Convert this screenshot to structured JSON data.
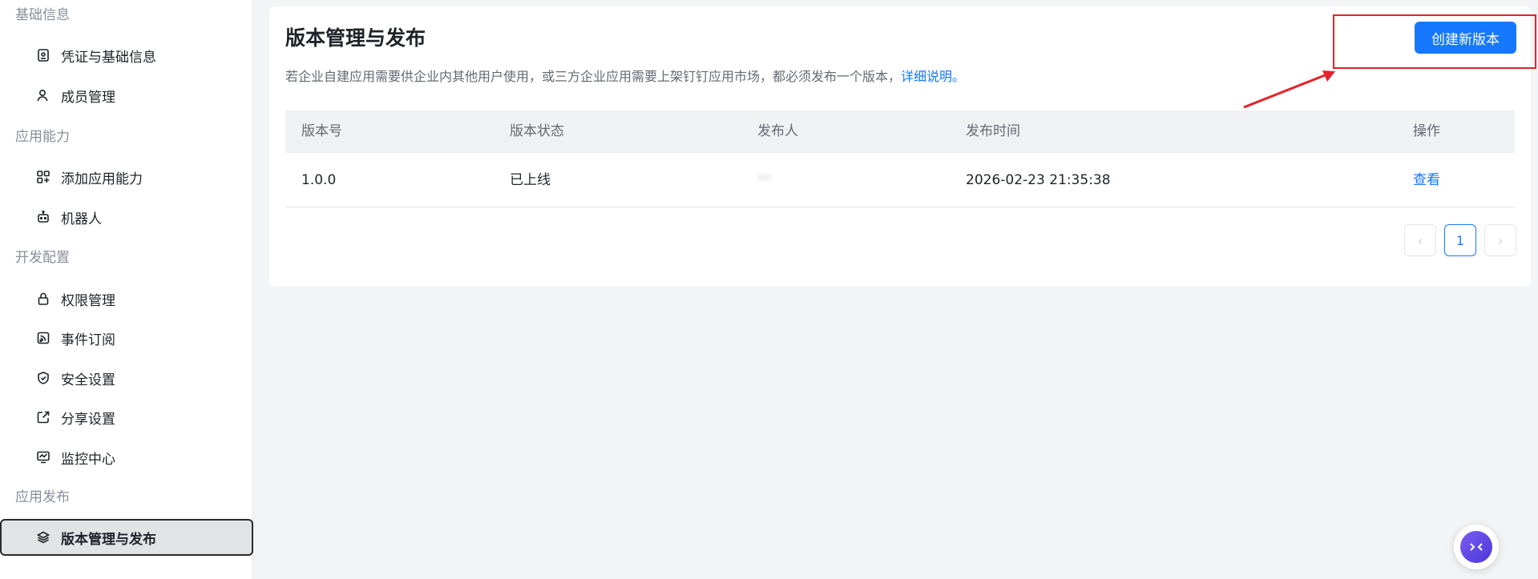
{
  "sidebar": {
    "groups": [
      {
        "title": "基础信息"
      },
      {
        "title": "应用能力"
      },
      {
        "title": "开发配置"
      },
      {
        "title": "应用发布"
      }
    ],
    "items": [
      {
        "label": "凭证与基础信息",
        "icon": "credential-icon"
      },
      {
        "label": "成员管理",
        "icon": "member-icon"
      },
      {
        "label": "添加应用能力",
        "icon": "add-capability-icon"
      },
      {
        "label": "机器人",
        "icon": "robot-icon"
      },
      {
        "label": "权限管理",
        "icon": "lock-icon"
      },
      {
        "label": "事件订阅",
        "icon": "subscription-icon"
      },
      {
        "label": "安全设置",
        "icon": "shield-icon"
      },
      {
        "label": "分享设置",
        "icon": "share-icon"
      },
      {
        "label": "监控中心",
        "icon": "monitor-icon"
      },
      {
        "label": "版本管理与发布",
        "icon": "layers-icon",
        "active": true
      }
    ]
  },
  "main": {
    "title": "版本管理与发布",
    "description": "若企业自建应用需要供企业内其他用户使用，或三方企业应用需要上架钉钉应用市场，都必须发布一个版本，",
    "description_link": "详细说明",
    "description_end": "。",
    "create_button": "创建新版本",
    "table": {
      "headers": [
        "版本号",
        "版本状态",
        "发布人",
        "发布时间",
        "操作"
      ],
      "rows": [
        {
          "version": "1.0.0",
          "status": "已上线",
          "publisher": "**",
          "time": "2026-02-23 21:35:38",
          "action": "查看"
        }
      ]
    },
    "pagination": {
      "prev": "‹",
      "current": "1",
      "next": "›"
    }
  },
  "colors": {
    "accent": "#1677ff",
    "highlight": "#e5222b"
  }
}
